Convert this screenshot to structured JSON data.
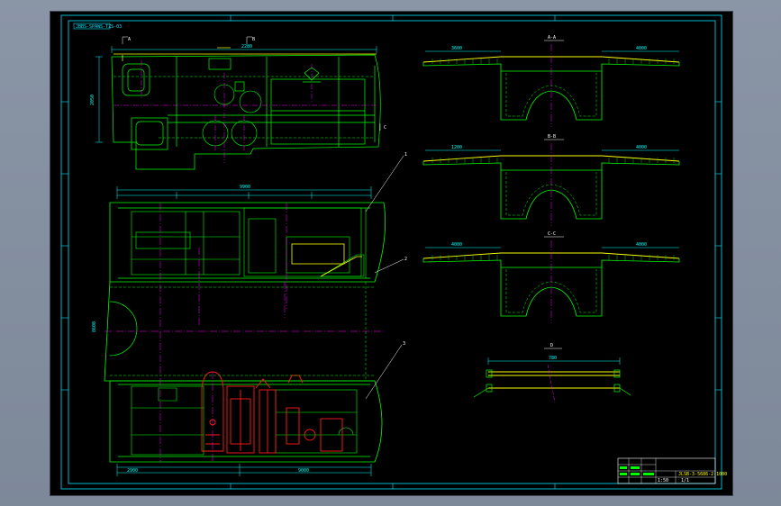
{
  "app": {
    "background_color": "#7d8899",
    "canvas_color": "#000000"
  },
  "colors": {
    "frame": "#00e5ff",
    "geometry": "#00ff00",
    "center_line": "#ff00ff",
    "hidden": "#ffff00",
    "equipment": "#ff1a1a",
    "dimension": "#00ffff",
    "text": "#ffffff"
  },
  "drawing": {
    "sheet_code": "JBBS-SPAWS-TZS-03",
    "plan_view": {
      "marks": [
        "A",
        "B",
        "C"
      ],
      "dims": {
        "top": "9900",
        "middle": "8600",
        "left": "2050",
        "bottom": "9000",
        "bottom_left": "2900",
        "top_a": "2280"
      }
    },
    "sections": [
      {
        "label": "A-A",
        "dim_left": "3600",
        "dim_right": "4000"
      },
      {
        "label": "B-B",
        "dim_left": "1200",
        "dim_right": "4000"
      },
      {
        "label": "C-C",
        "dim_left": "4000",
        "dim_right": "4000"
      }
    ],
    "detail": {
      "label": "D",
      "dim": "780"
    },
    "callouts": [
      "1",
      "2",
      "3"
    ],
    "title_block": {
      "drawing_no": "JLSB-3-5686-2-1000",
      "scale": "1:50",
      "sheet": "1/1"
    }
  }
}
